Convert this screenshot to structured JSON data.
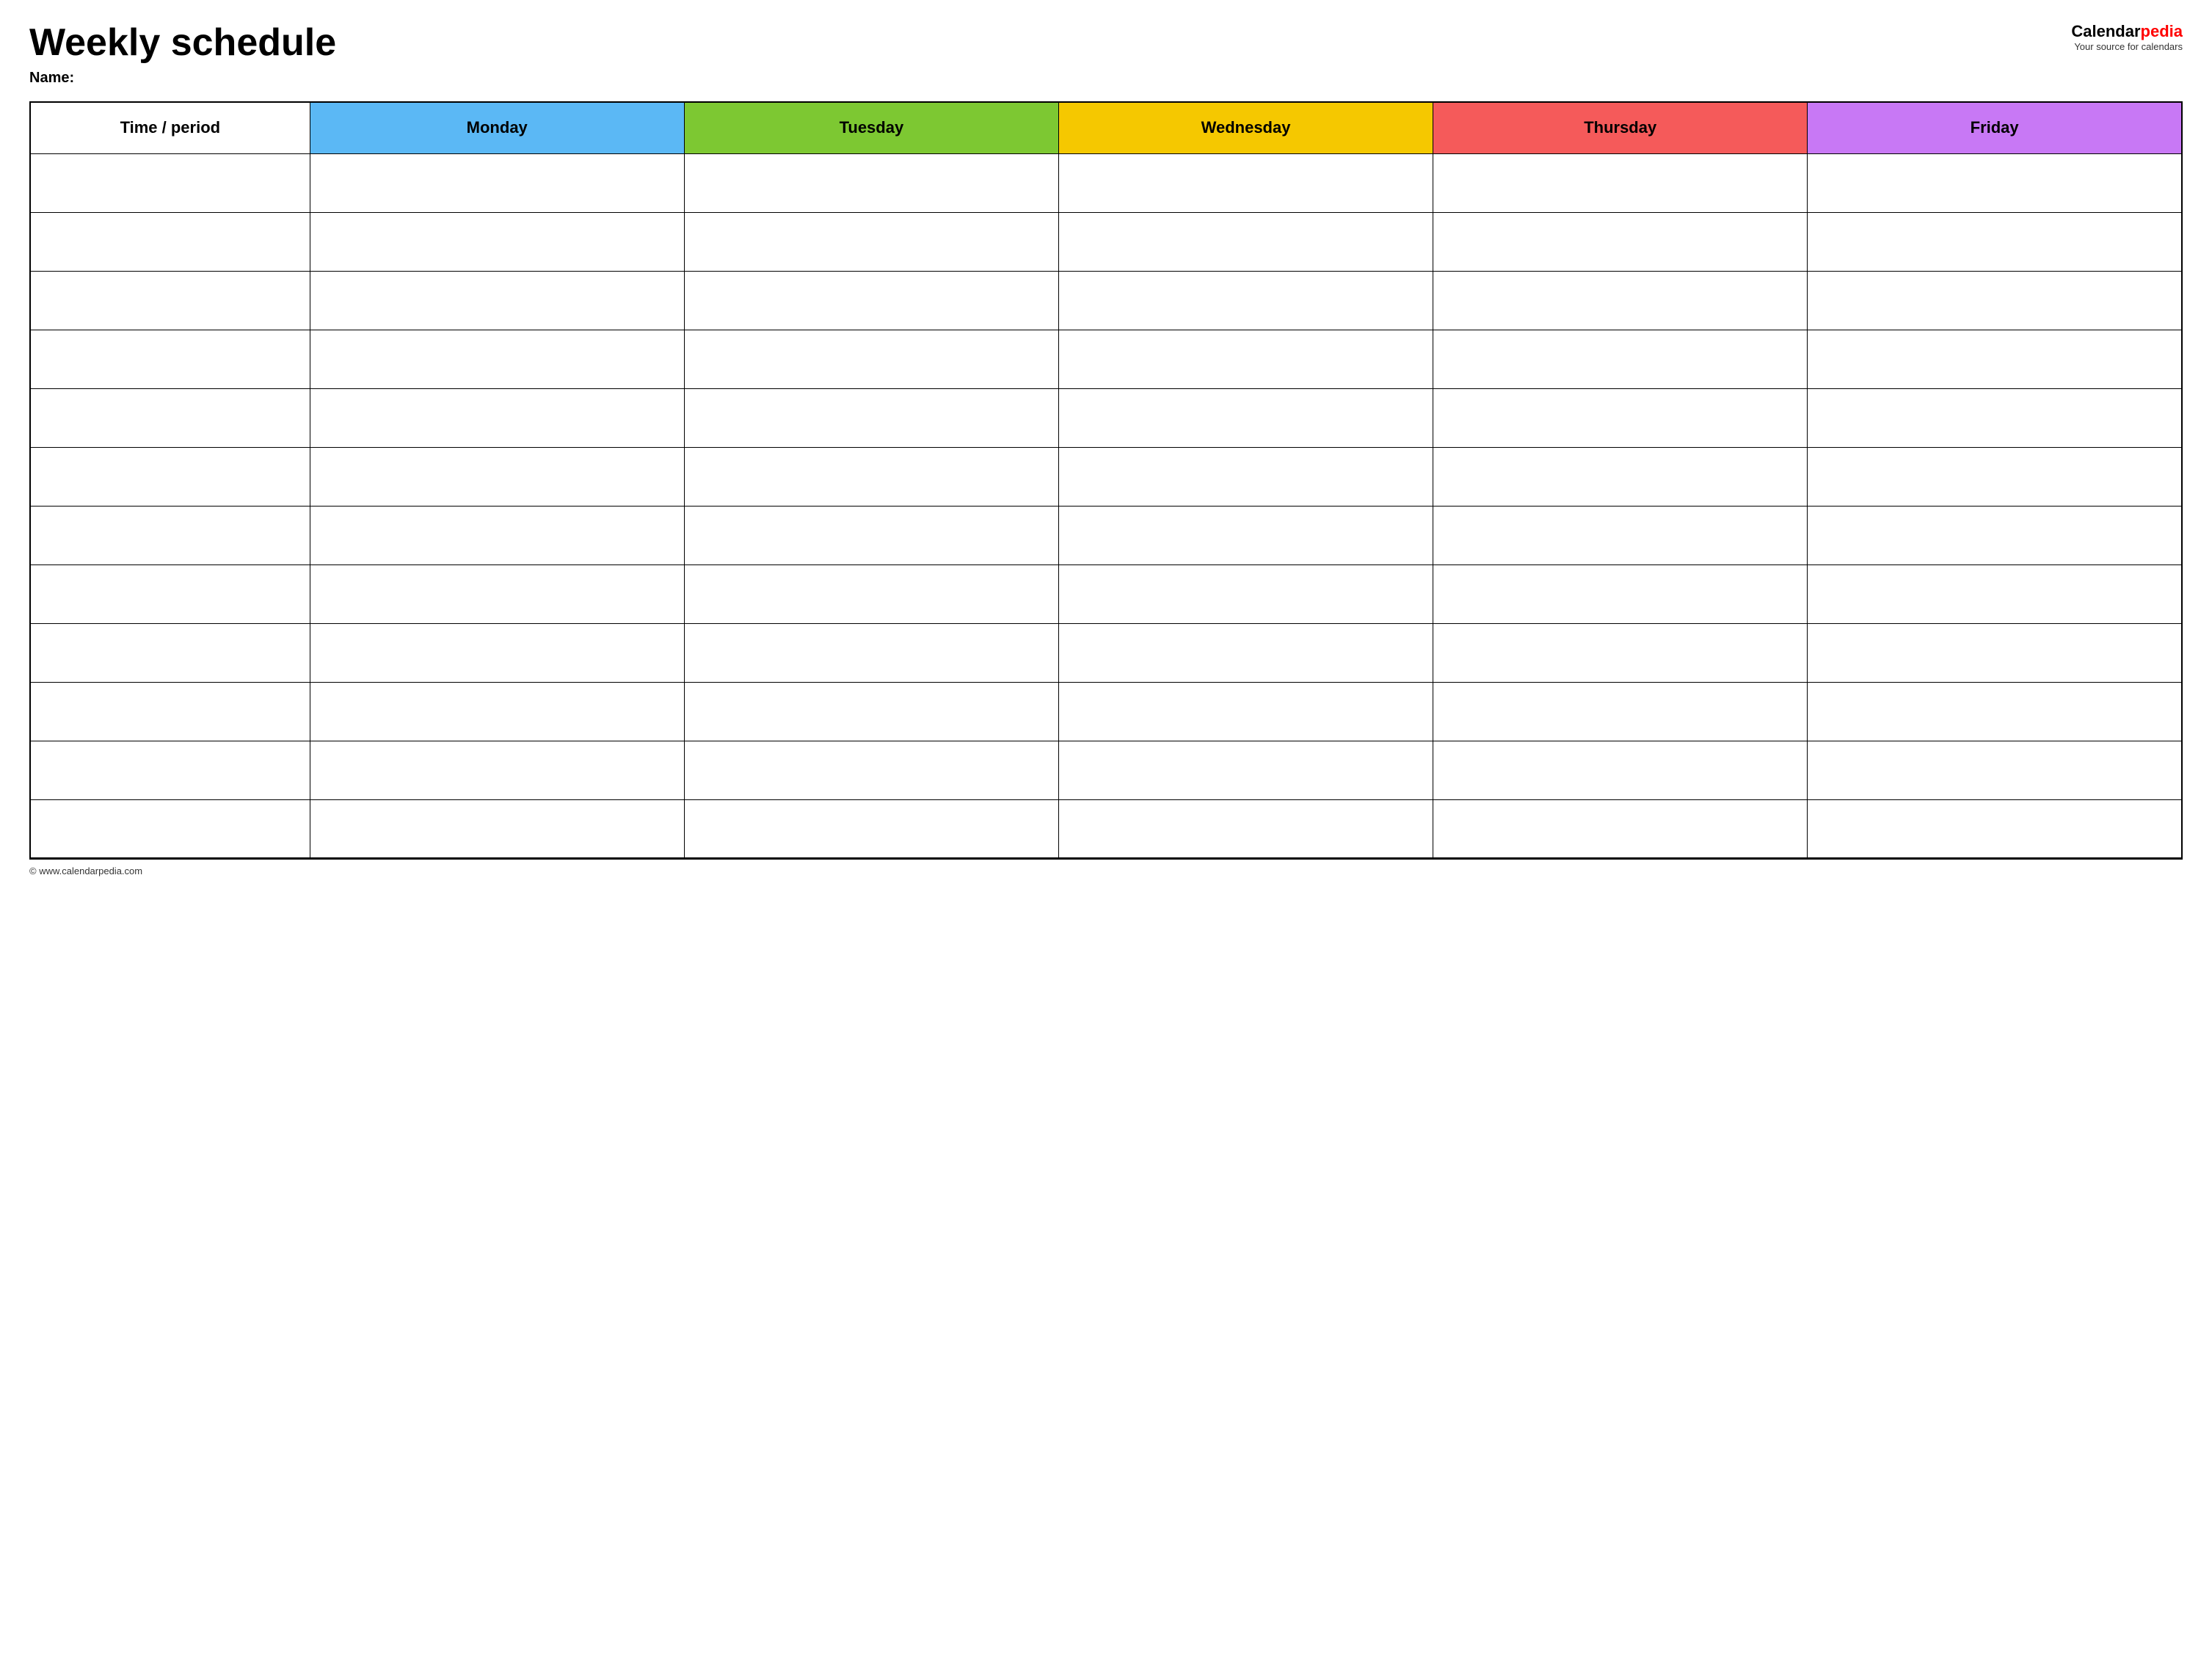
{
  "header": {
    "title": "Weekly schedule",
    "name_label": "Name:",
    "logo_calendar": "Calendar",
    "logo_pedia": "pedia",
    "logo_tagline": "Your source for calendars"
  },
  "table": {
    "columns": [
      {
        "id": "time",
        "label": "Time / period",
        "color": "#ffffff"
      },
      {
        "id": "monday",
        "label": "Monday",
        "color": "#5bb8f5"
      },
      {
        "id": "tuesday",
        "label": "Tuesday",
        "color": "#7dc832"
      },
      {
        "id": "wednesday",
        "label": "Wednesday",
        "color": "#f5c800"
      },
      {
        "id": "thursday",
        "label": "Thursday",
        "color": "#f55a5a"
      },
      {
        "id": "friday",
        "label": "Friday",
        "color": "#c878f5"
      }
    ],
    "row_count": 12
  },
  "footer": {
    "text": "© www.calendarpedia.com"
  }
}
